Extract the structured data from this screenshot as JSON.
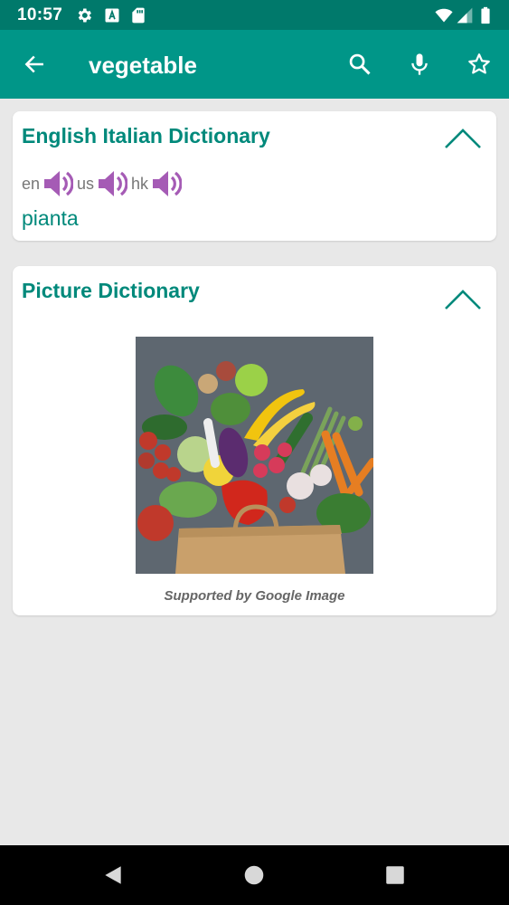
{
  "status_bar": {
    "time": "10:57",
    "icons": [
      "settings-icon",
      "a-notification-icon",
      "sd-card-icon",
      "wifi-icon",
      "signal-icon",
      "battery-icon"
    ]
  },
  "app_bar": {
    "title": "vegetable",
    "icons": [
      "back-arrow-icon",
      "search-icon",
      "microphone-icon",
      "star-icon"
    ]
  },
  "dictionary_card": {
    "title": "English Italian Dictionary",
    "pronunciations": [
      {
        "label": "en"
      },
      {
        "label": "us"
      },
      {
        "label": "hk"
      }
    ],
    "translation": "pianta"
  },
  "picture_card": {
    "title": "Picture Dictionary",
    "caption": "Supported by Google Image"
  },
  "colors": {
    "status_bar": "#00796b",
    "app_bar": "#009688",
    "accent": "#00897b",
    "speaker": "#a55bb5",
    "background": "#e8e8e8"
  }
}
